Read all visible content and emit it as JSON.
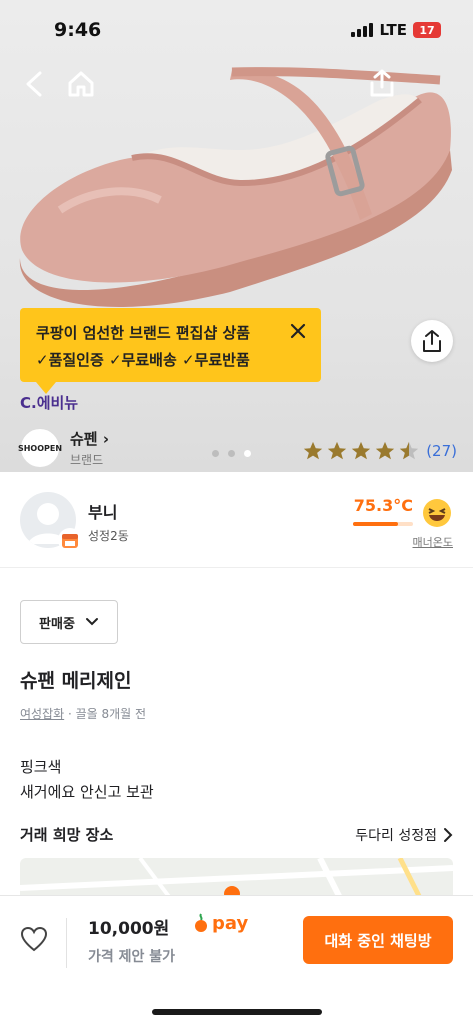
{
  "status_bar": {
    "time": "9:46",
    "network": "LTE",
    "battery": "17"
  },
  "hero": {
    "nav_icons": [
      "back-icon",
      "home-icon",
      "share-icon"
    ],
    "image_page_dots": 3,
    "active_dot": 3,
    "popup": {
      "line1": "쿠팡이 엄선한 브랜드 편집샵 상품",
      "line2": "✓품질인증 ✓무료배송 ✓무료반품",
      "close_icon": "close-icon"
    },
    "share_button_icon": "share-icon",
    "brand_logo_text": "C.에비뉴",
    "brand": {
      "avatar_text": "SHOOPEN",
      "name": "슈펜 ›",
      "sub": "브랜드"
    },
    "rating": {
      "stars": 4.5,
      "count": "(27)"
    }
  },
  "seller": {
    "name": "부니",
    "location": "성정2동",
    "temperature": "75.3°C",
    "temperature_fraction": 0.753,
    "temperature_label": "매너온도",
    "colors": {
      "accent": "#ff6f0f"
    }
  },
  "item": {
    "status": "판매중",
    "title": "슈팬 메리제인",
    "category": "여성잡화",
    "meta_rest": " · 끌올 8개월 전",
    "description": [
      "핑크색",
      "새거에요 안신고 보관"
    ],
    "place_label": "거래 희망 장소",
    "place_value": "두다리 성정점"
  },
  "bottom": {
    "price": "10,000원",
    "pay_label": "pay",
    "price_note": "가격 제안 불가",
    "chat_button": "대화 중인 채팅방"
  }
}
